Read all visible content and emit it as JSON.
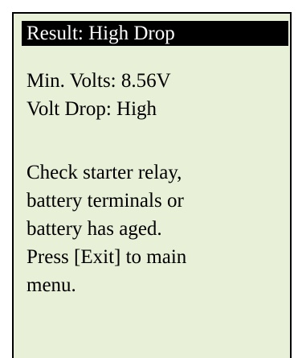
{
  "screen": {
    "title": "Result: High Drop",
    "readings": [
      "Min. Volts: 8.56V",
      "Volt Drop: High"
    ],
    "message_lines": [
      "Check starter relay,",
      "battery terminals or",
      "battery has aged.",
      "Press [Exit] to main",
      "menu."
    ]
  },
  "colors": {
    "screen_background": "#e8f0d8",
    "title_background": "#000000",
    "title_text": "#ffffff",
    "text": "#000000"
  }
}
